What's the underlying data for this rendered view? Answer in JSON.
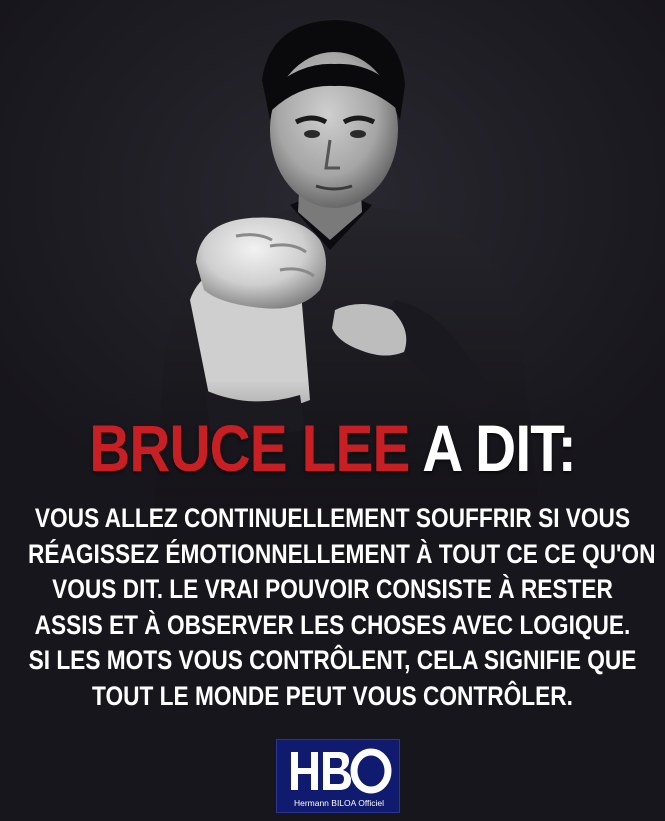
{
  "title": {
    "name_part": "BRUCE LEE",
    "rest_part": "A DIT:",
    "name_color": "#c81f25",
    "rest_color": "#ffffff"
  },
  "quote_lines": [
    "VOUS ALLEZ CONTINUELLEMENT SOUFFRIR SI VOUS",
    "RÉAGISSEZ ÉMOTIONNELLEMENT À TOUT CE CE QU'ON",
    "VOUS DIT. LE VRAI POUVOIR CONSISTE À RESTER",
    "ASSIS ET À OBSERVER LES CHOSES AVEC LOGIQUE.",
    "SI LES MOTS VOUS CONTRÔLENT, CELA SIGNIFIE QUE",
    "TOUT LE MONDE PEUT VOUS CONTRÔLER."
  ],
  "logo": {
    "caption": "Hermann BILOA Officiel",
    "background": "#101a6e"
  },
  "colors": {
    "background": "#17161c",
    "text": "#ffffff",
    "accent": "#c81f25"
  }
}
